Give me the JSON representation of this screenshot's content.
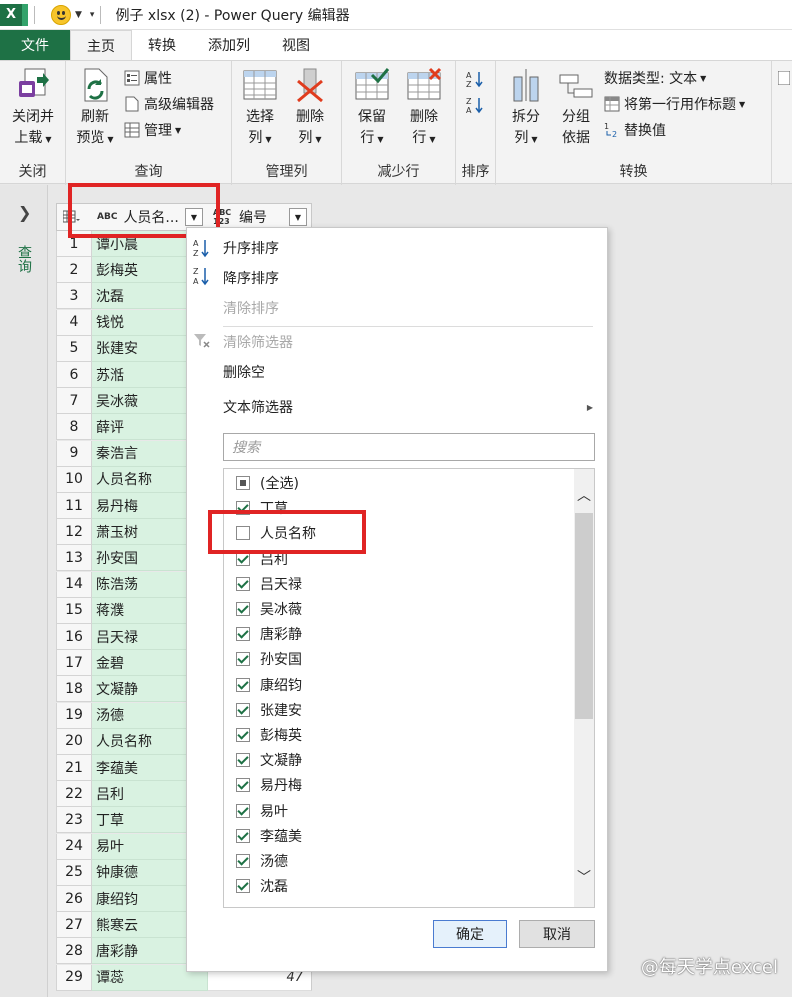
{
  "window": {
    "app_icon_letter": "X",
    "title": "例子 xlsx (2) - Power Query 编辑器"
  },
  "tabs": {
    "file": "文件",
    "home": "主页",
    "transform": "转换",
    "add_column": "添加列",
    "view": "视图"
  },
  "ribbon": {
    "close": {
      "close_load_line1": "关闭并",
      "close_load_line2": "上载",
      "label": "关闭"
    },
    "query": {
      "refresh_line1": "刷新",
      "refresh_line2": "预览",
      "properties": "属性",
      "advanced_editor": "高级编辑器",
      "manage": "管理",
      "label": "查询"
    },
    "manage_columns": {
      "choose_line1": "选择",
      "choose_line2": "列",
      "remove_line1": "删除",
      "remove_line2": "列",
      "label": "管理列"
    },
    "reduce_rows": {
      "keep_line1": "保留",
      "keep_line2": "行",
      "remove_line1": "删除",
      "remove_line2": "行",
      "label": "减少行"
    },
    "sort": {
      "label": "排序"
    },
    "transform": {
      "split_line1": "拆分",
      "split_line2": "列",
      "group_line1": "分组",
      "group_line2": "依据",
      "data_type": "数据类型: 文本",
      "first_row_header": "将第一行用作标题",
      "replace_values": "替换值",
      "label": "转换"
    }
  },
  "queries_pane": {
    "label": "查询"
  },
  "grid": {
    "col1_header": "人员名...",
    "col1_type": "ABC",
    "col2_header": "编号",
    "col2_type": "ABC 123",
    "rows": [
      {
        "n": "1",
        "name": "谭小晨"
      },
      {
        "n": "2",
        "name": "彭梅英"
      },
      {
        "n": "3",
        "name": "沈磊"
      },
      {
        "n": "4",
        "name": "钱悦"
      },
      {
        "n": "5",
        "name": "张建安"
      },
      {
        "n": "6",
        "name": "苏湉"
      },
      {
        "n": "7",
        "name": "吴冰薇"
      },
      {
        "n": "8",
        "name": "薛评"
      },
      {
        "n": "9",
        "name": "秦浩言"
      },
      {
        "n": "10",
        "name": "人员名称"
      },
      {
        "n": "11",
        "name": "易丹梅"
      },
      {
        "n": "12",
        "name": "萧玉树"
      },
      {
        "n": "13",
        "name": "孙安国"
      },
      {
        "n": "14",
        "name": "陈浩荡"
      },
      {
        "n": "15",
        "name": "蒋濮"
      },
      {
        "n": "16",
        "name": "吕天禄"
      },
      {
        "n": "17",
        "name": "金碧"
      },
      {
        "n": "18",
        "name": "文凝静"
      },
      {
        "n": "19",
        "name": "汤德"
      },
      {
        "n": "20",
        "name": "人员名称"
      },
      {
        "n": "21",
        "name": "李蕴美"
      },
      {
        "n": "22",
        "name": "吕利"
      },
      {
        "n": "23",
        "name": "丁草"
      },
      {
        "n": "24",
        "name": "易叶"
      },
      {
        "n": "25",
        "name": "钟康德"
      },
      {
        "n": "26",
        "name": "康绍钧"
      },
      {
        "n": "27",
        "name": "熊寒云"
      },
      {
        "n": "28",
        "name": "唐彩静"
      },
      {
        "n": "29",
        "name": "谭蕊",
        "num": "47"
      }
    ]
  },
  "menu": {
    "sort_asc": "升序排序",
    "sort_desc": "降序排序",
    "clear_sort": "清除排序",
    "clear_filter": "清除筛选器",
    "remove_empty": "删除空",
    "text_filters": "文本筛选器",
    "search_placeholder": "搜索",
    "list": [
      {
        "label": "(全选)",
        "state": "partial"
      },
      {
        "label": "丁草",
        "state": "checked"
      },
      {
        "label": "人员名称",
        "state": "unchecked"
      },
      {
        "label": "吕利",
        "state": "checked"
      },
      {
        "label": "吕天禄",
        "state": "checked"
      },
      {
        "label": "吴冰薇",
        "state": "checked"
      },
      {
        "label": "唐彩静",
        "state": "checked"
      },
      {
        "label": "孙安国",
        "state": "checked"
      },
      {
        "label": "康绍钧",
        "state": "checked"
      },
      {
        "label": "张建安",
        "state": "checked"
      },
      {
        "label": "彭梅英",
        "state": "checked"
      },
      {
        "label": "文凝静",
        "state": "checked"
      },
      {
        "label": "易丹梅",
        "state": "checked"
      },
      {
        "label": "易叶",
        "state": "checked"
      },
      {
        "label": "李蕴美",
        "state": "checked"
      },
      {
        "label": "汤德",
        "state": "checked"
      },
      {
        "label": "沈磊",
        "state": "checked"
      }
    ],
    "ok": "确定",
    "cancel": "取消"
  },
  "watermark": "@每天学点excel"
}
